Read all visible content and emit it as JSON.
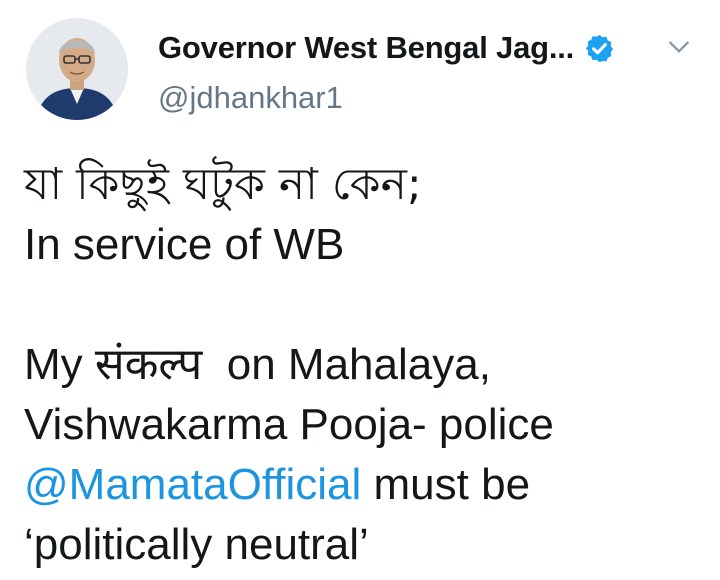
{
  "user": {
    "display_name": "Governor West Bengal Jag...",
    "handle": "@jdhankhar1",
    "verified": true
  },
  "tweet": {
    "line1": "যা কিছুই ঘটুক না কেন;",
    "line2": "In service of WB",
    "line3_prefix": "My ",
    "line3_word": "संकल्प",
    "line3_suffix": "  on Mahalaya,",
    "line4": "Vishwakarma Pooja- police",
    "mention": "@MamataOfficial",
    "line5_suffix": " must be",
    "line6": "‘politically neutral’"
  },
  "colors": {
    "accent": "#1b95e0",
    "text": "#14171a",
    "secondary": "#657786"
  },
  "icons": {
    "verified": "verified-badge-icon",
    "menu": "chevron-down-icon"
  }
}
